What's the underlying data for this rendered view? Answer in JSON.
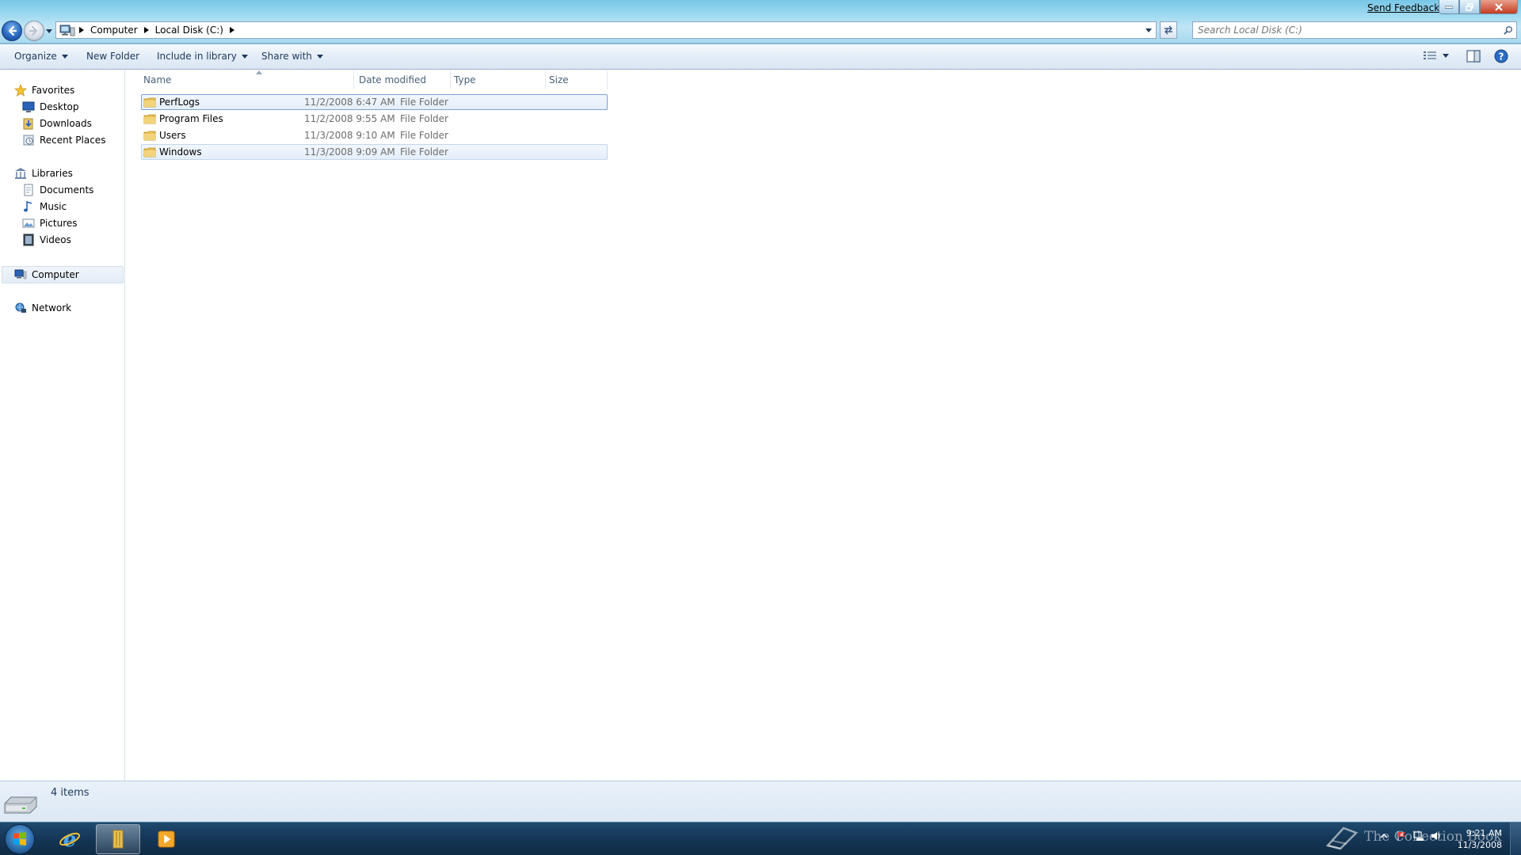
{
  "window": {
    "send_feedback": "Send Feedback"
  },
  "address": {
    "crumbs": [
      "Computer",
      "Local Disk (C:)"
    ]
  },
  "search": {
    "placeholder": "Search Local Disk (C:)"
  },
  "toolbar": {
    "organize": "Organize",
    "new_folder": "New Folder",
    "include_in_library": "Include in library",
    "share_with": "Share with"
  },
  "nav": {
    "favorites": {
      "label": "Favorites",
      "items": [
        {
          "label": "Desktop",
          "icon": "desktop-icon"
        },
        {
          "label": "Downloads",
          "icon": "downloads-icon"
        },
        {
          "label": "Recent Places",
          "icon": "recent-places-icon"
        }
      ]
    },
    "libraries": {
      "label": "Libraries",
      "items": [
        {
          "label": "Documents",
          "icon": "documents-icon"
        },
        {
          "label": "Music",
          "icon": "music-icon"
        },
        {
          "label": "Pictures",
          "icon": "pictures-icon"
        },
        {
          "label": "Videos",
          "icon": "videos-icon"
        }
      ]
    },
    "computer": "Computer",
    "network": "Network"
  },
  "columns": {
    "name": "Name",
    "date_modified": "Date modified",
    "type": "Type",
    "size": "Size"
  },
  "files": [
    {
      "name": "PerfLogs",
      "date": "11/2/2008 6:47 AM",
      "type": "File Folder",
      "selected": true,
      "focused": true
    },
    {
      "name": "Program Files",
      "date": "11/2/2008 9:55 AM",
      "type": "File Folder",
      "selected": false,
      "focused": false
    },
    {
      "name": "Users",
      "date": "11/3/2008 9:10 AM",
      "type": "File Folder",
      "selected": false,
      "focused": false
    },
    {
      "name": "Windows",
      "date": "11/3/2008 9:09 AM",
      "type": "File Folder",
      "selected": true,
      "focused": false
    }
  ],
  "details": {
    "items_count": "4 items"
  },
  "taskbar": {
    "apps": [
      "internet-explorer-icon",
      "windows-explorer-icon",
      "media-player-icon"
    ],
    "clock_time": "9:21 AM",
    "clock_date": "11/3/2008"
  },
  "watermark": "The Collection Book",
  "colors": {
    "title_gradient": "#9ad7ee",
    "toolbar_text": "#1e395b",
    "selection": "#e4eefa",
    "taskbar": "#153656"
  }
}
